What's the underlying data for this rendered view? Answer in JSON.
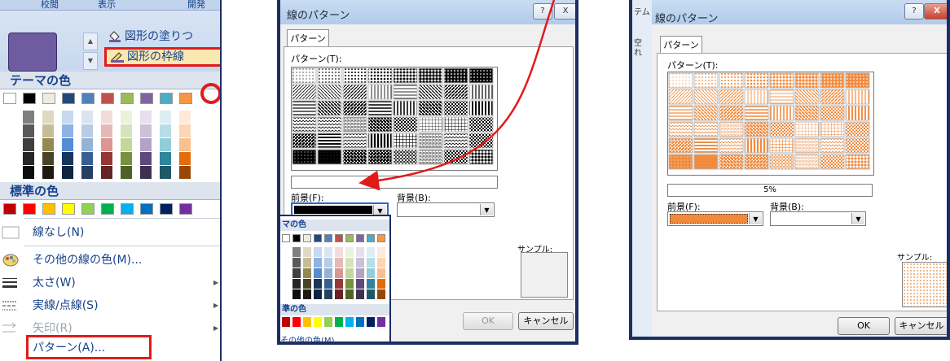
{
  "panel1": {
    "ribbon_tabs": [
      "校閲",
      "表示",
      "開発"
    ],
    "fill_item": "図形の塗りつ",
    "outline_item": "図形の枠線",
    "theme_colors_header": "テーマの色",
    "standard_colors_header": "標準の色",
    "theme_top_colors": [
      "#ffffff",
      "#000000",
      "#eeece1",
      "#1f497d",
      "#4f81bd",
      "#c0504d",
      "#9bbb59",
      "#8064a2",
      "#4bacc6",
      "#f79646"
    ],
    "theme_shade_columns": [
      [
        "#7f7f7f",
        "#595959",
        "#3f3f3f",
        "#262626",
        "#0c0c0c"
      ],
      [
        "#ddd9c3",
        "#c4bd97",
        "#938953",
        "#494429",
        "#1d1b10"
      ],
      [
        "#c6d9f0",
        "#8db3e2",
        "#548dd4",
        "#17365d",
        "#0f243e"
      ],
      [
        "#dbe5f1",
        "#b8cce4",
        "#95b3d7",
        "#366092",
        "#244061"
      ],
      [
        "#f2dcdb",
        "#e5b9b7",
        "#d99694",
        "#953734",
        "#632423"
      ],
      [
        "#ebf1dd",
        "#d7e3bc",
        "#c3d69b",
        "#76923c",
        "#4f6128"
      ],
      [
        "#e5e0ec",
        "#ccc1d9",
        "#b2a2c7",
        "#5f497a",
        "#3f3151"
      ],
      [
        "#dbeef3",
        "#b7dde8",
        "#92cddc",
        "#31859b",
        "#205867"
      ],
      [
        "#fdeada",
        "#fbd5b5",
        "#fac08f",
        "#e36c09",
        "#974806"
      ]
    ],
    "standard_colors": [
      "#c00000",
      "#ff0000",
      "#ffc000",
      "#ffff00",
      "#92d050",
      "#00b050",
      "#00b0f0",
      "#0070c0",
      "#002060",
      "#7030a0"
    ],
    "menu": [
      {
        "label": "線なし(N)",
        "arrow": false
      },
      {
        "label": "その他の線の色(M)...",
        "arrow": false
      },
      {
        "label": "太さ(W)",
        "arrow": true
      },
      {
        "label": "実線/点線(S)",
        "arrow": true
      },
      {
        "label": "矢印(R)",
        "arrow": true
      },
      {
        "label": "パターン(A)...",
        "arrow": false
      }
    ]
  },
  "panel2": {
    "title": "線のパターン",
    "help_btn": "?",
    "close_btn": "X",
    "tab": "パターン",
    "pattern_label": "パターン(T):",
    "foreground_label": "前景(F):",
    "background_label": "背景(B):",
    "sample_label": "サンプル:",
    "ok": "OK",
    "cancel": "キャンセル",
    "popup_theme_header": "マの色",
    "popup_standard_header": "準の色",
    "popup_other": "その他の色(M)...",
    "pattern_color": "#000000"
  },
  "panel3": {
    "title": "線のパターン",
    "help_btn": "?",
    "close_btn": "X",
    "tab": "パターン",
    "pattern_label": "パターン(T):",
    "pattern_name": "5%",
    "foreground_label": "前景(F):",
    "background_label": "背景(B):",
    "sample_label": "サンプル:",
    "ok": "OK",
    "cancel": "キャンセル",
    "strip_text": [
      "テム",
      "空",
      "れ"
    ],
    "pattern_color": "#f28a3c"
  },
  "colors": {
    "highlight": "#e31a1a",
    "frame": "#1d2e63",
    "link": "#15428b"
  }
}
